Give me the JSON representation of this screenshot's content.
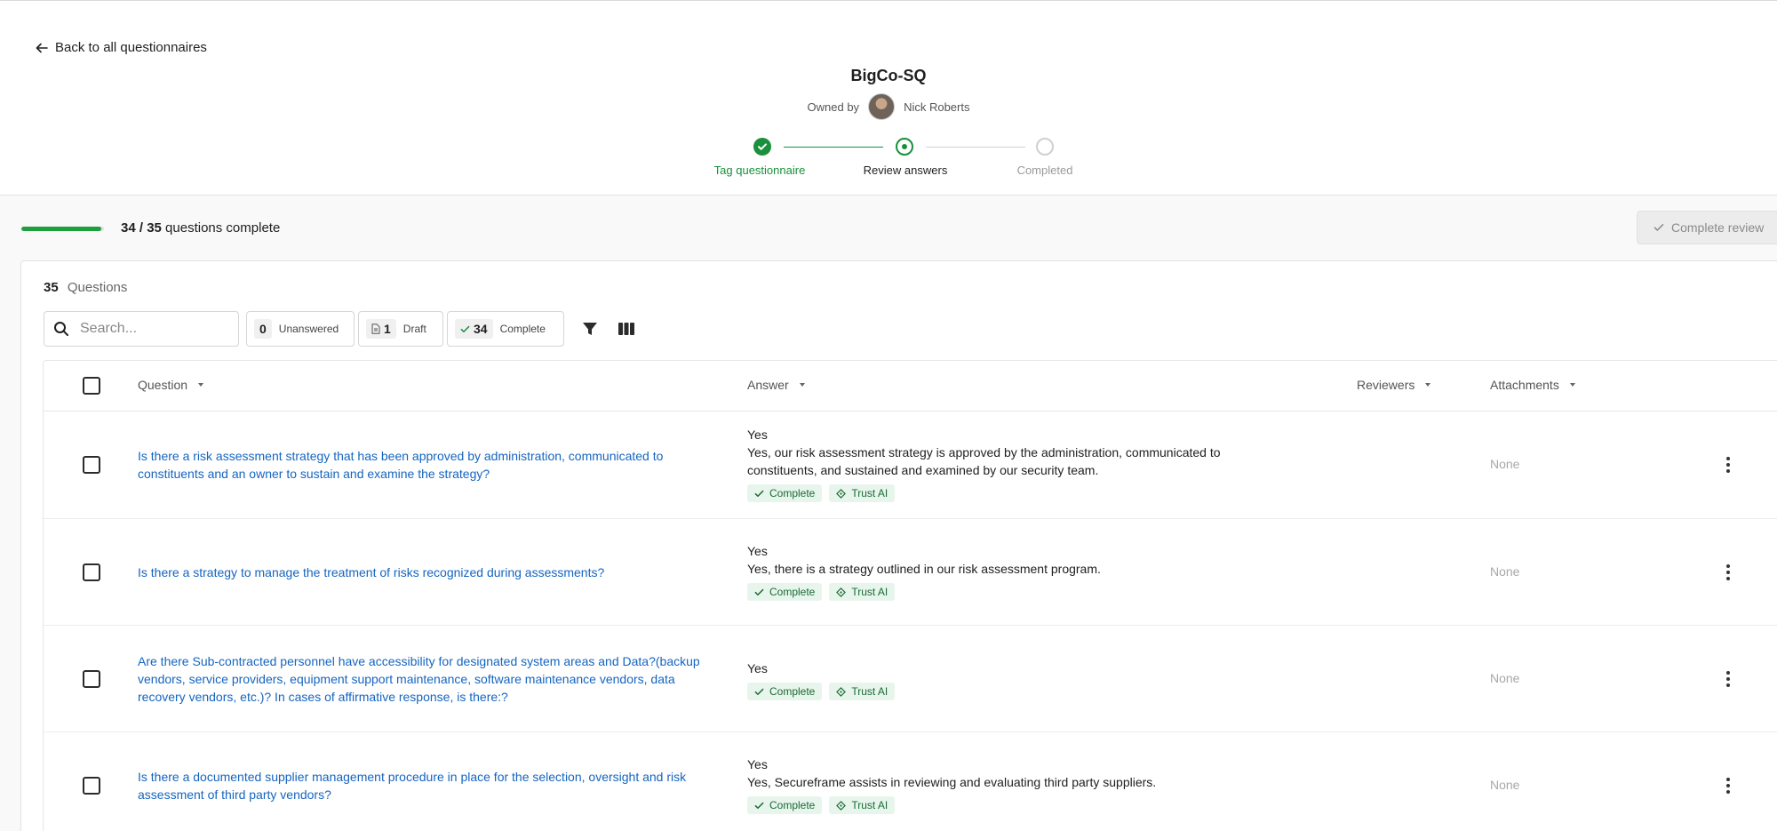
{
  "header": {
    "back_label": "Back to all questionnaires",
    "title": "BigCo-SQ",
    "owned_by_label": "Owned by",
    "owner_name": "Nick Roberts",
    "steps": [
      {
        "label": "Tag questionnaire",
        "state": "done"
      },
      {
        "label": "Review answers",
        "state": "current"
      },
      {
        "label": "Completed",
        "state": "future"
      }
    ]
  },
  "progress": {
    "completed": "34",
    "separator": " / ",
    "total": "35",
    "suffix": " questions complete",
    "fraction": 0.971,
    "complete_review_label": "Complete review"
  },
  "questions_panel": {
    "count": "35",
    "count_label": "Questions",
    "search_placeholder": "Search...",
    "filters": [
      {
        "count": "0",
        "label": "Unanswered"
      },
      {
        "count": "1",
        "label": "Draft"
      },
      {
        "count": "34",
        "label": "Complete"
      }
    ],
    "columns": [
      "Question",
      "Answer",
      "Reviewers",
      "Attachments"
    ],
    "rows": [
      {
        "question": "Is there a risk assessment strategy that has been approved by administration, communicated to constituents and an owner to sustain and examine the strategy?",
        "answer_short": "Yes",
        "answer_detail": "Yes, our risk assessment strategy is approved by the administration, communicated to constituents, and sustained and examined by our security team.",
        "tag_complete": "Complete",
        "tag_source": "Trust AI",
        "attachments": "None"
      },
      {
        "question": "Is there a strategy to manage the treatment of risks recognized during assessments?",
        "answer_short": "Yes",
        "answer_detail": "Yes, there is a strategy outlined in our risk assessment program.",
        "tag_complete": "Complete",
        "tag_source": "Trust AI",
        "attachments": "None"
      },
      {
        "question": "Are there Sub-contracted personnel have accessibility for designated system areas and Data?(backup vendors, service providers, equipment support maintenance, software maintenance vendors, data recovery vendors, etc.)? In cases of affirmative response, is there:?",
        "answer_short": "Yes",
        "answer_detail": "",
        "tag_complete": "Complete",
        "tag_source": "Trust AI",
        "attachments": "None"
      },
      {
        "question": "Is there a documented supplier management procedure in place for the selection, oversight and risk assessment of third party vendors?",
        "answer_short": "Yes",
        "answer_detail": "Yes, Secureframe assists in reviewing and evaluating third party suppliers.",
        "tag_complete": "Complete",
        "tag_source": "Trust AI",
        "attachments": "None"
      }
    ]
  },
  "colors": {
    "accent_green": "#1a8f3c",
    "link_blue": "#1565c0",
    "tag_bg": "#e8f5ec"
  }
}
